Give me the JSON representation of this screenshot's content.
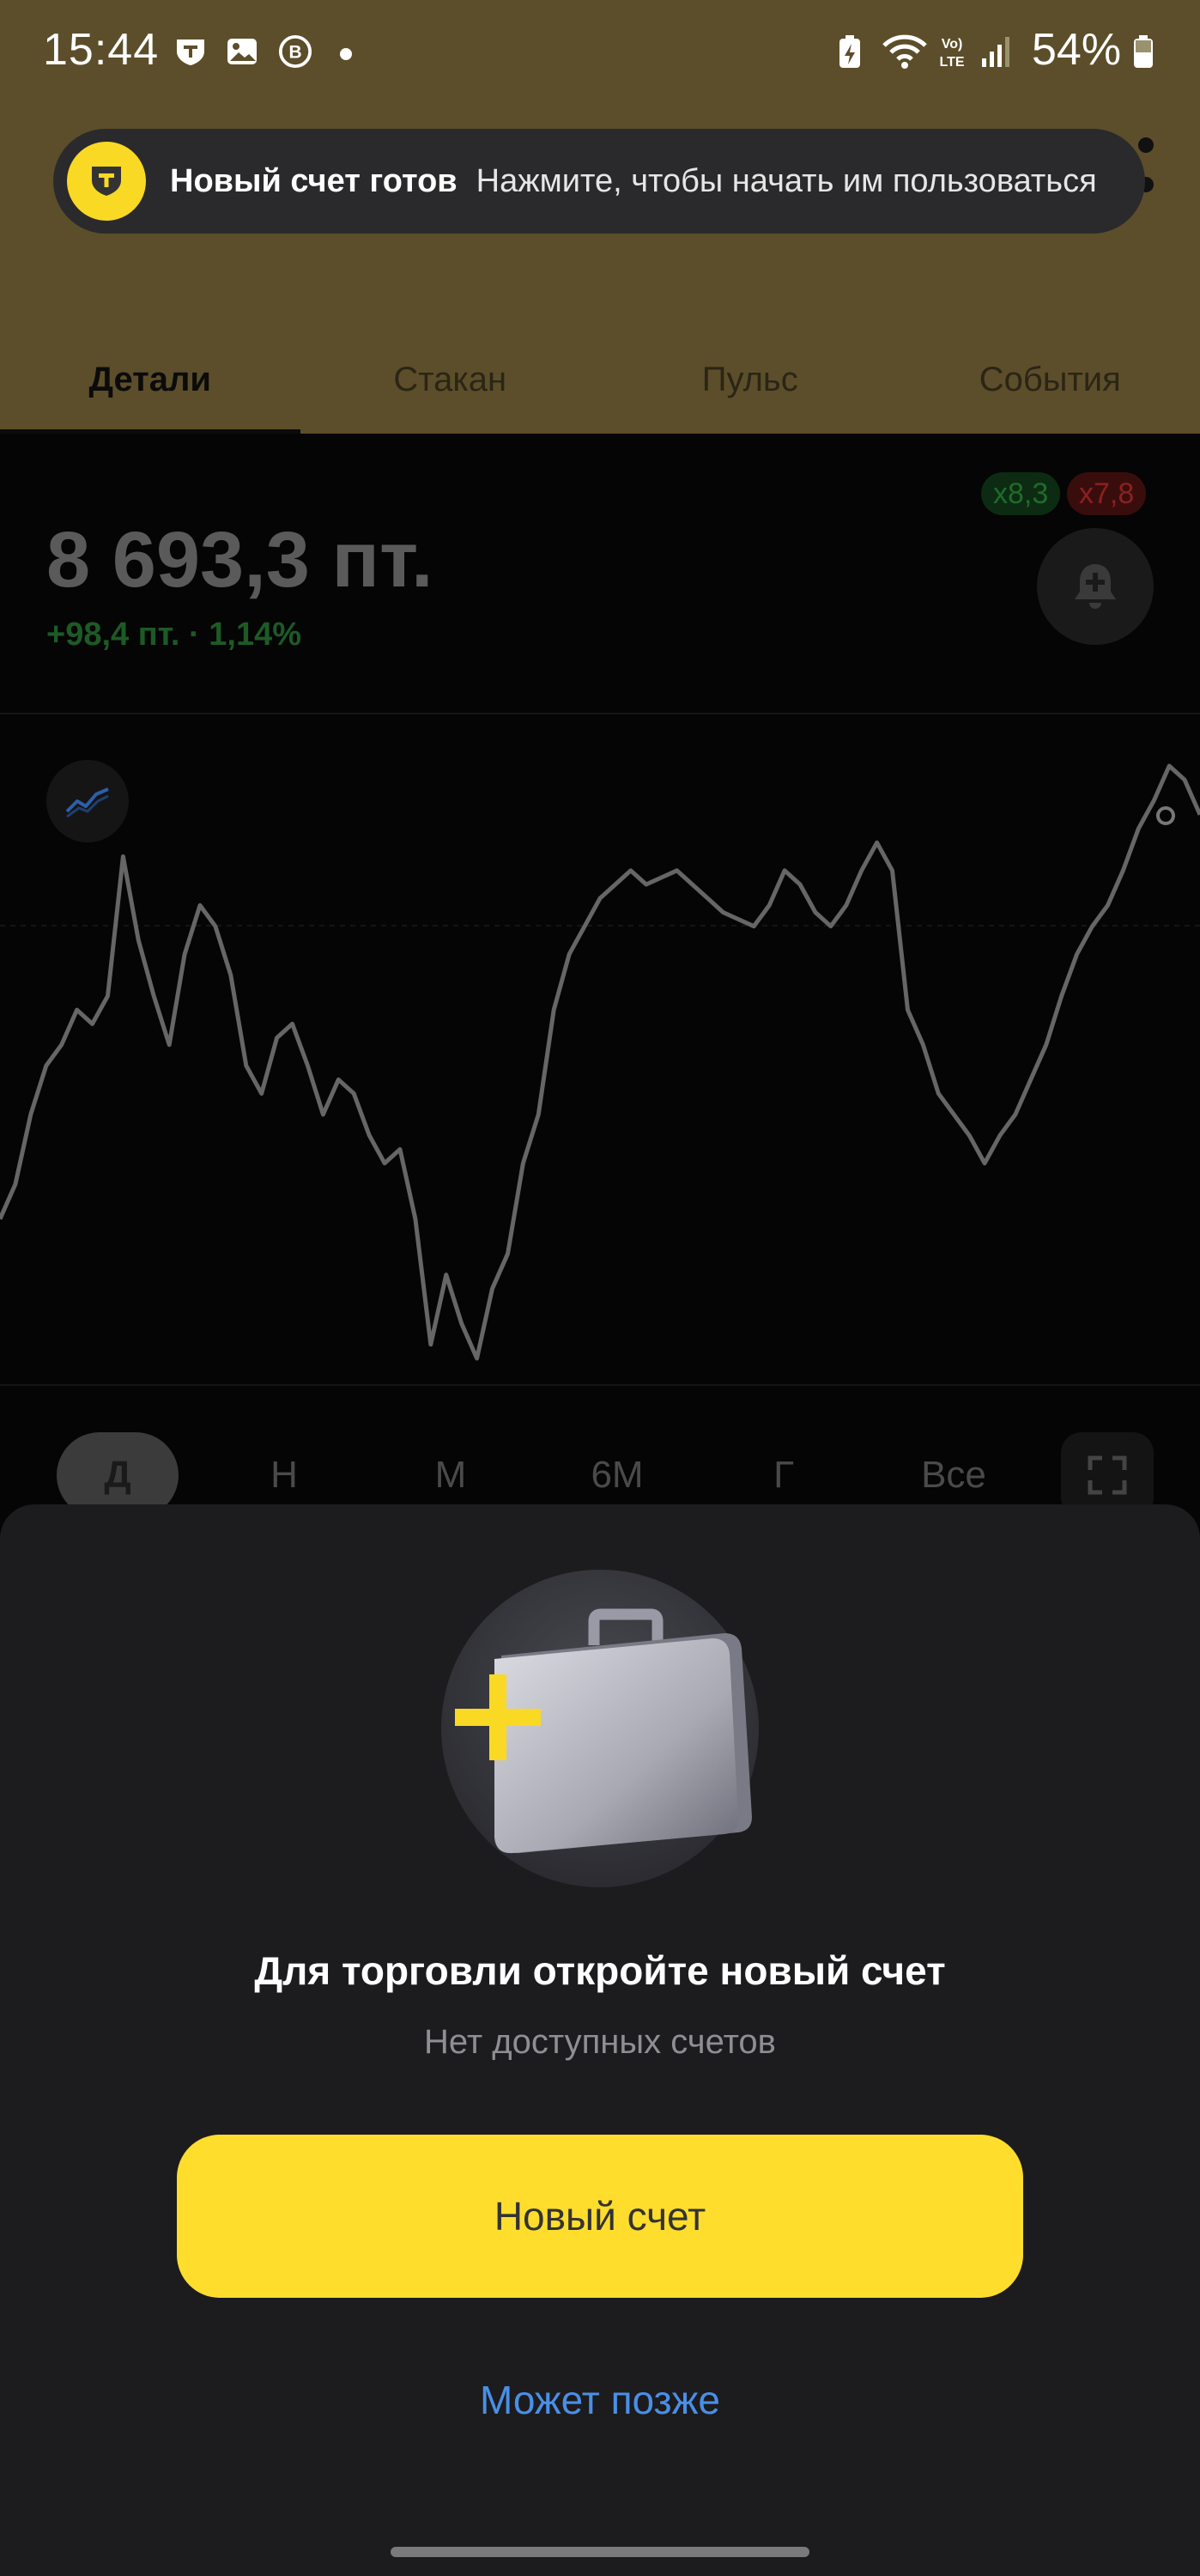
{
  "status_bar": {
    "time": "15:44",
    "battery": "54%",
    "icons": [
      "t-bank-notification-icon",
      "gallery-icon",
      "b-app-icon",
      "dot-icon",
      "battery-saver-icon",
      "wifi-icon",
      "volte-icon",
      "signal-icon",
      "battery-icon"
    ]
  },
  "notification": {
    "title": "Новый счет готов",
    "text": "Нажмите, чтобы начать им пользоваться"
  },
  "tabs": [
    {
      "label": "Детали",
      "active": true
    },
    {
      "label": "Стакан",
      "active": false
    },
    {
      "label": "Пульс",
      "active": false
    },
    {
      "label": "События",
      "active": false
    }
  ],
  "quote": {
    "price": "8 693,3 пт.",
    "change": "+98,4 пт. · 1,14%",
    "badge_buy": "x8,3",
    "badge_sell": "x7,8"
  },
  "chart_data": {
    "type": "line",
    "series": [
      {
        "values": [
          30,
          35,
          45,
          52,
          55,
          60,
          58,
          62,
          82,
          70,
          62,
          55,
          68,
          75,
          72,
          65,
          52,
          48,
          56,
          58,
          52,
          45,
          50,
          48,
          42,
          38,
          40,
          30,
          12,
          22,
          15,
          10,
          20,
          25,
          38,
          45,
          60,
          68,
          72,
          76,
          78,
          80,
          78,
          79,
          80,
          78,
          76,
          74,
          73,
          72,
          75,
          80,
          78,
          74,
          72,
          75,
          80,
          84,
          80,
          60,
          55,
          48,
          45,
          42,
          38,
          42,
          45,
          50,
          55,
          62,
          68,
          72,
          75,
          80,
          86,
          90,
          95,
          93,
          88
        ]
      }
    ]
  },
  "periods": [
    {
      "label": "Д",
      "active": true
    },
    {
      "label": "Н",
      "active": false
    },
    {
      "label": "М",
      "active": false
    },
    {
      "label": "6М",
      "active": false
    },
    {
      "label": "Г",
      "active": false
    },
    {
      "label": "Все",
      "active": false
    }
  ],
  "sheet": {
    "title": "Для торговли откройте новый счет",
    "subtitle": "Нет доступных счетов",
    "primary_button": "Новый счет",
    "secondary_button": "Может позже"
  },
  "colors": {
    "header": "#5c4e2a",
    "accent_yellow": "#ffdd2d",
    "link_blue": "#4a8fe7",
    "positive": "#1d5a26"
  }
}
